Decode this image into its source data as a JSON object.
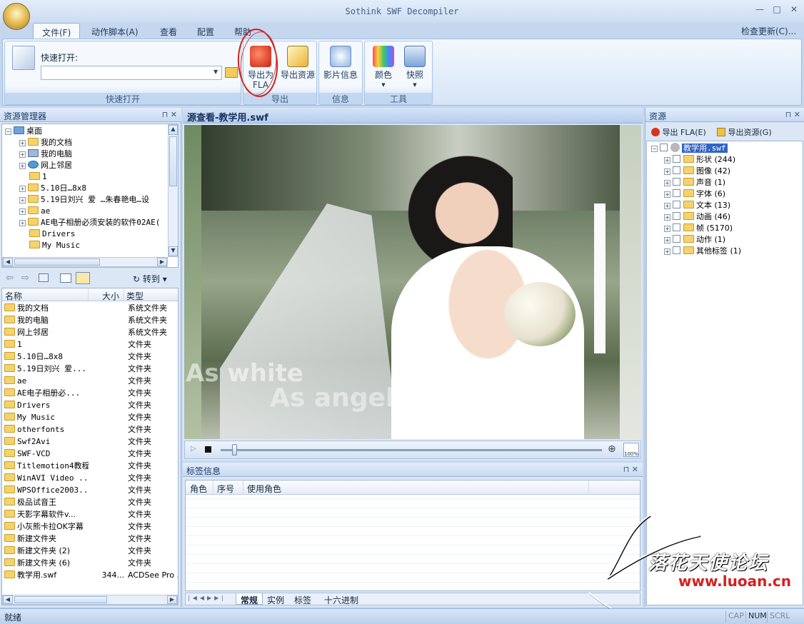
{
  "app": {
    "title": "Sothink SWF Decompiler"
  },
  "window": {
    "minimize": "—",
    "maximize": "□",
    "close": "✕"
  },
  "menu_tabs": [
    "文件(F)",
    "动作脚本(A)",
    "查看",
    "配置",
    "帮助"
  ],
  "check_update": "检查更新(C)...",
  "ribbon": {
    "quick_open": {
      "label": "快速打开:",
      "value": "",
      "group": "快速打开"
    },
    "export_group": {
      "export_fla": "导出为FLA",
      "export_resources": "导出资源",
      "label": "导出"
    },
    "info_group": {
      "movie_info": "影片信息",
      "label": "信息"
    },
    "tools_group": {
      "color": "颜色",
      "snapshot": "快照",
      "label": "工具"
    }
  },
  "explorer": {
    "title": "资源管理器",
    "tree": [
      "桌面",
      "我的文档",
      "我的电脑",
      "网上邻居",
      "1",
      "5.10日…8x8",
      "5.19日刘兴 爱  …朱春艳电…设",
      "ae",
      "AE电子相册必须安装的软件02AE(",
      "Drivers",
      "My Music"
    ],
    "goto": "转到",
    "columns": {
      "name": "名称",
      "size": "大小",
      "type": "类型"
    },
    "files": [
      {
        "name": "我的文档",
        "size": "",
        "type": "系统文件夹"
      },
      {
        "name": "我的电脑",
        "size": "",
        "type": "系统文件夹"
      },
      {
        "name": "网上邻居",
        "size": "",
        "type": "系统文件夹"
      },
      {
        "name": "1",
        "size": "",
        "type": "文件夹"
      },
      {
        "name": "5.10日…8x8",
        "size": "",
        "type": "文件夹"
      },
      {
        "name": "5.19日刘兴 爱...",
        "size": "",
        "type": "文件夹"
      },
      {
        "name": "ae",
        "size": "",
        "type": "文件夹"
      },
      {
        "name": "AE电子相册必...",
        "size": "",
        "type": "文件夹"
      },
      {
        "name": "Drivers",
        "size": "",
        "type": "文件夹"
      },
      {
        "name": "My Music",
        "size": "",
        "type": "文件夹"
      },
      {
        "name": "otherfonts",
        "size": "",
        "type": "文件夹"
      },
      {
        "name": "Swf2Avi",
        "size": "",
        "type": "文件夹"
      },
      {
        "name": "SWF-VCD",
        "size": "",
        "type": "文件夹"
      },
      {
        "name": "Titlemotion4教程",
        "size": "",
        "type": "文件夹"
      },
      {
        "name": "WinAVI Video ...",
        "size": "",
        "type": "文件夹"
      },
      {
        "name": "WPSOffice2003...",
        "size": "",
        "type": "文件夹"
      },
      {
        "name": "极品试音王",
        "size": "",
        "type": "文件夹"
      },
      {
        "name": "天影字幕软件v...",
        "size": "",
        "type": "文件夹"
      },
      {
        "name": "小灰熊卡拉OK字幕",
        "size": "",
        "type": "文件夹"
      },
      {
        "name": "新建文件夹",
        "size": "",
        "type": "文件夹"
      },
      {
        "name": "新建文件夹 (2)",
        "size": "",
        "type": "文件夹"
      },
      {
        "name": "新建文件夹 (6)",
        "size": "",
        "type": "文件夹"
      },
      {
        "name": "教学用.swf",
        "size": "344...",
        "type": "ACDSee Pro ..."
      }
    ]
  },
  "preview": {
    "title": "源查看-教学用.swf",
    "overlay_line1": "As white",
    "overlay_line2": "As angel",
    "zoom": "100%",
    "progress": 0.03
  },
  "tag_info": {
    "title": "标签信息",
    "columns": [
      "角色",
      "序号",
      "使用角色"
    ],
    "tabs": [
      "常规",
      "实例",
      "标签",
      "十六进制"
    ]
  },
  "resources": {
    "title": "资源",
    "export_fla": "导出 FLA(E)",
    "export_resources": "导出资源(G)",
    "root": "教学用.swf",
    "items": [
      "形状 (244)",
      "图像 (42)",
      "声音 (1)",
      "字体 (6)",
      "文本 (13)",
      "动画 (46)",
      "帧 (5170)",
      "动作 (1)",
      "其他标签 (1)"
    ]
  },
  "status": {
    "text": "就绪",
    "cap": "CAP",
    "num": "NUM",
    "scrl": "SCRL"
  },
  "watermark": {
    "text": "落花天使论坛",
    "url": "www.luoan.cn"
  },
  "colors": {
    "annotation": "#cc2222",
    "accent": "#c5d7ee"
  }
}
